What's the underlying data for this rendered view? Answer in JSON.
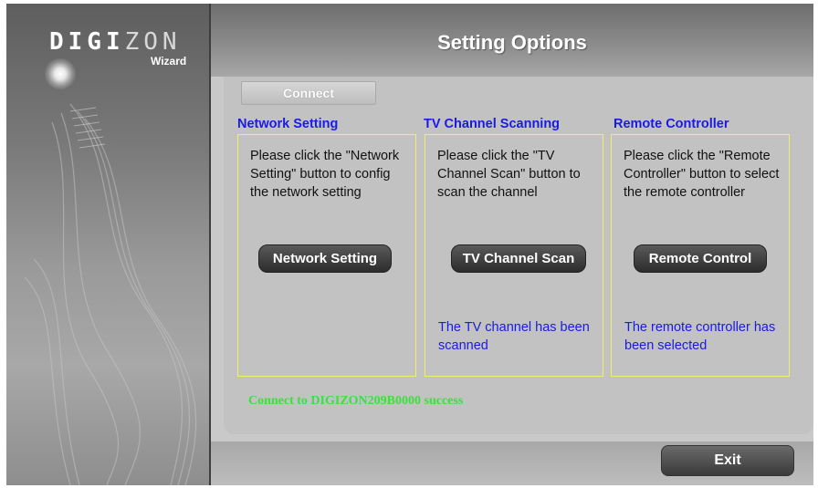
{
  "brand": {
    "logo_main": "DIGI",
    "logo_accent": "ZON",
    "logo_sub": "Wizard"
  },
  "header": {
    "title": "Setting Options"
  },
  "tabs": {
    "connect": "Connect"
  },
  "sections": [
    {
      "title": "Network Setting",
      "description": "Please click the \"Network Setting\" button to config the network setting",
      "button": "Network Setting",
      "status": ""
    },
    {
      "title": "TV Channel Scanning",
      "description": "Please click the \"TV Channel Scan\" button to scan the channel",
      "button": "TV Channel Scan",
      "status": "The TV channel has been scanned"
    },
    {
      "title": "Remote Controller",
      "description": "Please click the \"Remote Controller\" button to select the remote controller",
      "button": "Remote Control",
      "status": "The remote controller has been selected"
    }
  ],
  "connection_status": "Connect to DIGIZON209B0000 success",
  "footer": {
    "exit_label": "Exit"
  },
  "colors": {
    "section_title": "#1a1ae6",
    "status_text": "#1a1ae6",
    "success_text": "#3ce03c",
    "panel_border": "#f0f060"
  }
}
